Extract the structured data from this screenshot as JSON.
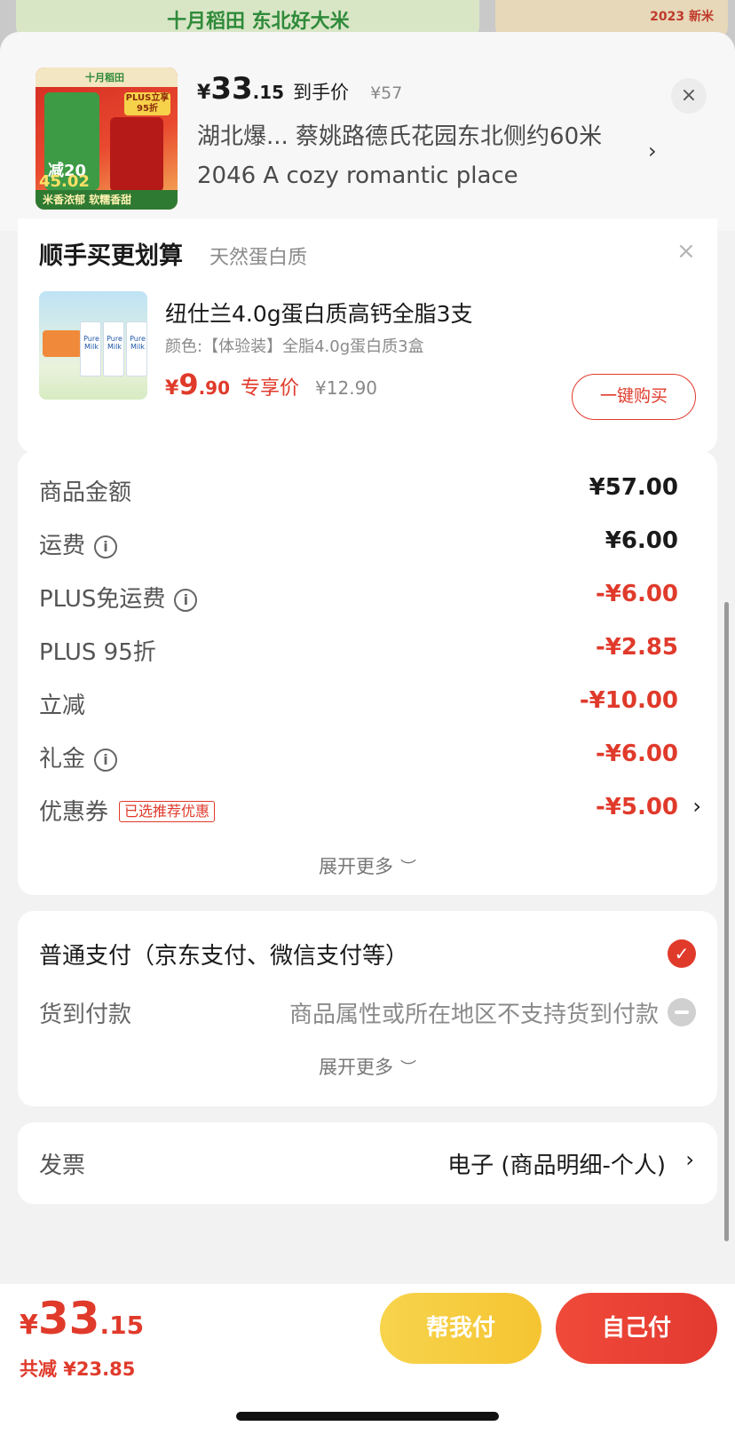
{
  "background": {
    "banner_a_text": "十月稻田 东北好大米",
    "banner_b_text": "2023 新米"
  },
  "header": {
    "thumb": {
      "brand_text": "十月稻田",
      "top_badge": "PLUS立享95折",
      "green_text": "减20",
      "price_text": "45.02",
      "bottom_text": "米香浓郁 软糯香甜"
    },
    "price": {
      "currency": "¥",
      "integer": "33",
      "decimal": ".15",
      "label": "到手价",
      "original": "¥57"
    },
    "address": "湖北爆... 蔡姚路德氏花园东北侧约60米2046 A cozy romantic place",
    "close_icon": "×",
    "chevron": "›"
  },
  "upsell": {
    "title": "顺手买更划算",
    "subtitle": "天然蛋白质",
    "close_icon": "×",
    "product_name": "纽仕兰4.0g蛋白质高钙全脂3支",
    "spec": "颜色:【体验装】全脂4.0g蛋白质3盒",
    "thumb_box_label": "Pure Milk",
    "price": {
      "currency": "¥",
      "integer": "9",
      "decimal": ".90",
      "label": "专享价",
      "original": "¥12.90"
    },
    "buy_label": "一键购买"
  },
  "breakdown": {
    "rows": [
      {
        "label": "商品金额",
        "value": "¥57.00"
      },
      {
        "label": "运费",
        "value": "¥6.00"
      },
      {
        "label": "PLUS免运费",
        "value": "-¥6.00"
      },
      {
        "label": "PLUS 95折",
        "value": "-¥2.85"
      },
      {
        "label": "立减",
        "value": "-¥10.00"
      },
      {
        "label": "礼金",
        "value": "-¥6.00"
      },
      {
        "label": "优惠券",
        "value": "-¥5.00",
        "tag": "已选推荐优惠"
      }
    ],
    "info_icon": "i",
    "expand_label": "展开更多",
    "expand_chevron": "︶"
  },
  "payment": {
    "main_label": "普通支付（京东支付、微信支付等）",
    "check_icon": "✓",
    "cod_label": "货到付款",
    "cod_note": "商品属性或所在地区不支持货到付款",
    "expand_label": "展开更多",
    "expand_chevron": "︶"
  },
  "invoice": {
    "label": "发票",
    "value": "电子 (商品明细-个人)",
    "chevron": "›"
  },
  "bottom": {
    "total_currency": "¥",
    "total_integer": "33",
    "total_decimal": ".15",
    "saving": "共减 ¥23.85",
    "help_pay_label": "帮我付",
    "self_pay_label": "自己付"
  },
  "colors": {
    "accent_red": "#e03a2b",
    "help_yellow": "#f7d44c"
  }
}
